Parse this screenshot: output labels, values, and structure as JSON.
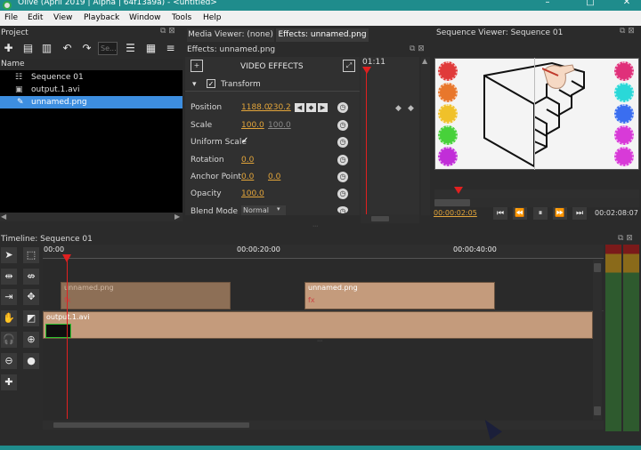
{
  "window": {
    "title": "Olive (April 2019 | Alpha | 64f13a9a) - <untitled>"
  },
  "menubar": {
    "items": [
      "File",
      "Edit",
      "View",
      "Playback",
      "Window",
      "Tools",
      "Help"
    ]
  },
  "project": {
    "title": "Project",
    "search_placeholder": "Se...",
    "column_name": "Name",
    "items": [
      {
        "label": "Sequence 01",
        "icon": "sequence-icon"
      },
      {
        "label": "output.1.avi",
        "icon": "video-file-icon"
      },
      {
        "label": "unnamed.png",
        "icon": "image-file-icon"
      }
    ]
  },
  "effects": {
    "tabs": [
      "Media Viewer: (none)",
      "Effects: unnamed.png"
    ],
    "header": "Effects: unnamed.png",
    "video_effects_label": "VIDEO EFFECTS",
    "transform_label": "Transform",
    "timecode": "01:11",
    "rows": [
      {
        "label": "Position",
        "v1": "1188.0",
        "v2": "230.2"
      },
      {
        "label": "Scale",
        "v1": "100.0",
        "v2": "100.0"
      },
      {
        "label": "Uniform Scale",
        "v1": "",
        "v2": ""
      },
      {
        "label": "Rotation",
        "v1": "0.0",
        "v2": ""
      },
      {
        "label": "Anchor Point",
        "v1": "0.0",
        "v2": "0.0"
      },
      {
        "label": "Opacity",
        "v1": "100.0",
        "v2": ""
      },
      {
        "label": "Blend Mode",
        "v1": "Normal",
        "v2": ""
      }
    ]
  },
  "viewer": {
    "title": "Sequence Viewer: Sequence 01",
    "current_time": "00:00:02:05",
    "end_time": "00:02:08:07",
    "colors_left": [
      "#e03a3a",
      "#e8772c",
      "#f0c12a",
      "#47d13a",
      "#c12ed8"
    ],
    "colors_right": [
      "#e0307a",
      "#2ad8d8",
      "#3a6ef0",
      "#d83ad8",
      "#d83ad8"
    ]
  },
  "timeline": {
    "title": "Timeline: Sequence 01",
    "ruler": [
      "00:00",
      "00:00:20:00",
      "00:00:40:00"
    ],
    "clips": [
      {
        "label": "unnamed.png"
      },
      {
        "label": "unnamed.png"
      },
      {
        "label": "output.1.avi"
      }
    ]
  }
}
